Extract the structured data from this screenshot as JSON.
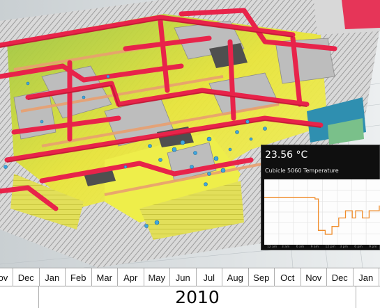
{
  "colors": {
    "duct": "#e8234a",
    "heat_high": "#e8e820",
    "heat_mid": "#b8d23a",
    "sensor": "#3fa7e0",
    "line": "#f08c2a"
  },
  "tooltip": {
    "value": "23.56 °C",
    "label": "Cubicle 5060 Temperature",
    "time_ticks": [
      "12 am",
      "3 am",
      "6 am",
      "9 am",
      "12 pm",
      "3 pm",
      "6 pm",
      "9 pm"
    ],
    "series": [
      0.72,
      0.72,
      0.72,
      0.72,
      0.72,
      0.72,
      0.72,
      0.72,
      0.72,
      0.72,
      0.72,
      0.72,
      0.72,
      0.72,
      0.72,
      0.7,
      0.22,
      0.22,
      0.16,
      0.16,
      0.28,
      0.28,
      0.41,
      0.41,
      0.52,
      0.52,
      0.41,
      0.52,
      0.52,
      0.41,
      0.41,
      0.52,
      0.52,
      0.52,
      0.6
    ]
  },
  "timeline": {
    "months": [
      "Nov",
      "Dec",
      "Jan",
      "Feb",
      "Mar",
      "Apr",
      "May",
      "Jun",
      "Jul",
      "Aug",
      "Sep",
      "Oct",
      "Nov",
      "Dec",
      "Jan"
    ],
    "year": "2010"
  }
}
